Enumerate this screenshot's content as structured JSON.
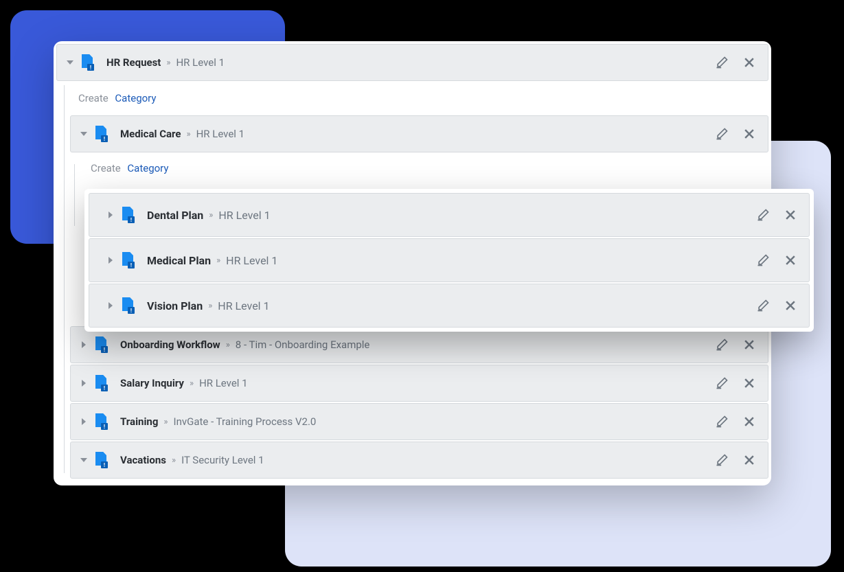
{
  "create": {
    "label": "Create",
    "link": "Category"
  },
  "separator": "»",
  "root": {
    "title": "HR Request",
    "desc": "HR Level 1",
    "expanded": true
  },
  "medical": {
    "title": "Medical Care",
    "desc": "HR Level 1",
    "expanded": true,
    "children": [
      {
        "title": "Dental Plan",
        "desc": "HR Level 1"
      },
      {
        "title": "Medical Plan",
        "desc": "HR Level 1"
      },
      {
        "title": "Vision Plan",
        "desc": "HR Level 1"
      }
    ]
  },
  "siblings": [
    {
      "title": "Onboarding Workflow",
      "desc": "8 - Tim - Onboarding Example",
      "expanded": false
    },
    {
      "title": "Salary Inquiry",
      "desc": "HR Level 1",
      "expanded": false
    },
    {
      "title": "Training",
      "desc": "InvGate - Training Process V2.0",
      "expanded": false
    },
    {
      "title": "Vacations",
      "desc": "IT Security Level 1",
      "expanded": true
    }
  ],
  "colors": {
    "bg_left": "#3959d9",
    "bg_bottom": "#dde3f8",
    "icon_blue": "#1a8cf1",
    "link": "#1c5bb8"
  }
}
